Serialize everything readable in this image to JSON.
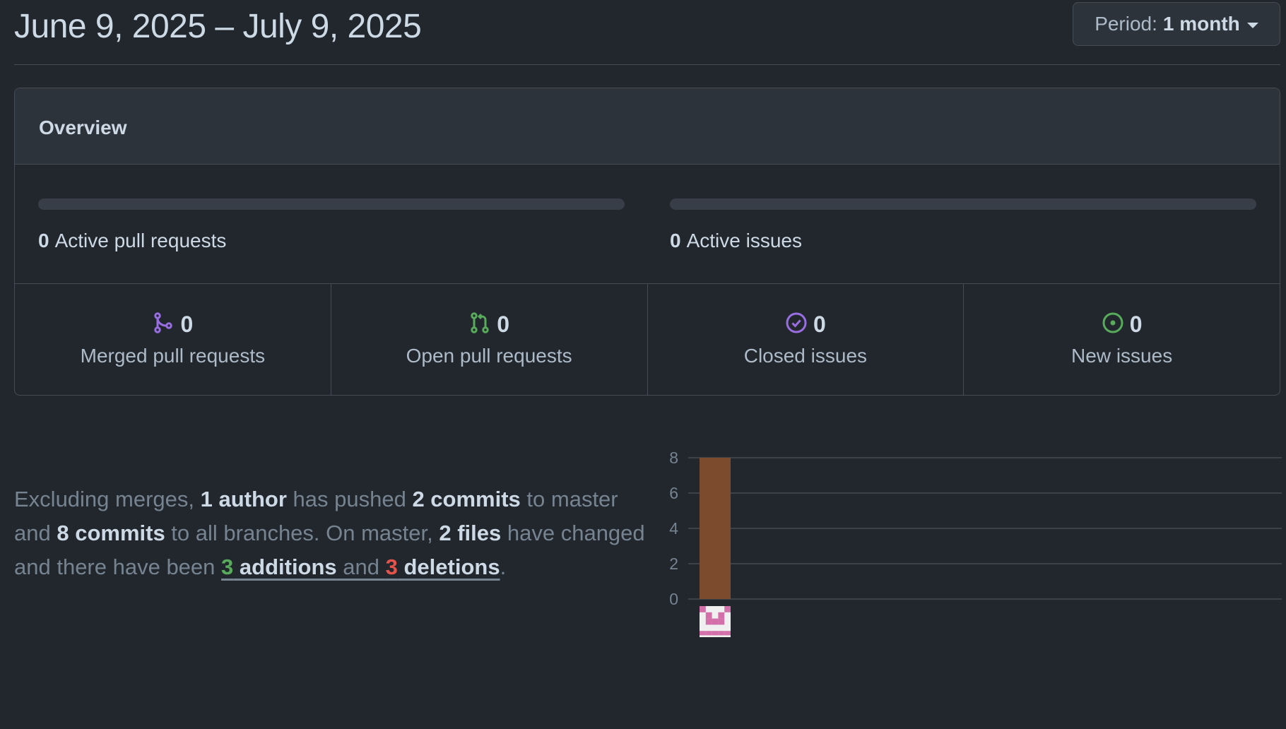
{
  "header": {
    "date_range": "June 9, 2025 – July 9, 2025",
    "period_label": "Period:",
    "period_value": "1 month"
  },
  "overview": {
    "title": "Overview",
    "active_pull_requests": {
      "count": "0",
      "label": "Active pull requests",
      "fill_fraction": 0
    },
    "active_issues": {
      "count": "0",
      "label": "Active issues",
      "fill_fraction": 0
    },
    "stats": [
      {
        "icon": "git-merge-icon",
        "count": "0",
        "label": "Merged pull requests",
        "color": "#986ee2"
      },
      {
        "icon": "git-pull-request-icon",
        "count": "0",
        "label": "Open pull requests",
        "color": "#57ab5a"
      },
      {
        "icon": "issue-closed-icon",
        "count": "0",
        "label": "Closed issues",
        "color": "#986ee2"
      },
      {
        "icon": "issue-opened-icon",
        "count": "0",
        "label": "New issues",
        "color": "#57ab5a"
      }
    ]
  },
  "summary": {
    "t1": "Excluding merges, ",
    "authors": "1 author",
    "t2": " has pushed ",
    "master_commits": "2 commits",
    "t3": " to master and ",
    "all_commits": "8 commits",
    "t4": " to all branches. On master, ",
    "files": "2 files",
    "t5": " have changed and there have been ",
    "additions_num": "3",
    "additions_word": " additions",
    "t6": " and ",
    "deletions_num": "3",
    "deletions_word": " deletions",
    "t7": "."
  },
  "colors": {
    "bar": "#7c4a2d",
    "avatar": "#d36fa9",
    "additions": "#57ab5a",
    "deletions": "#e5534b"
  },
  "chart_data": {
    "type": "bar",
    "categories": [
      "author-1"
    ],
    "values": [
      8
    ],
    "ylim": [
      0,
      8
    ],
    "yticks": [
      0,
      2,
      4,
      6,
      8
    ],
    "grid": true
  }
}
